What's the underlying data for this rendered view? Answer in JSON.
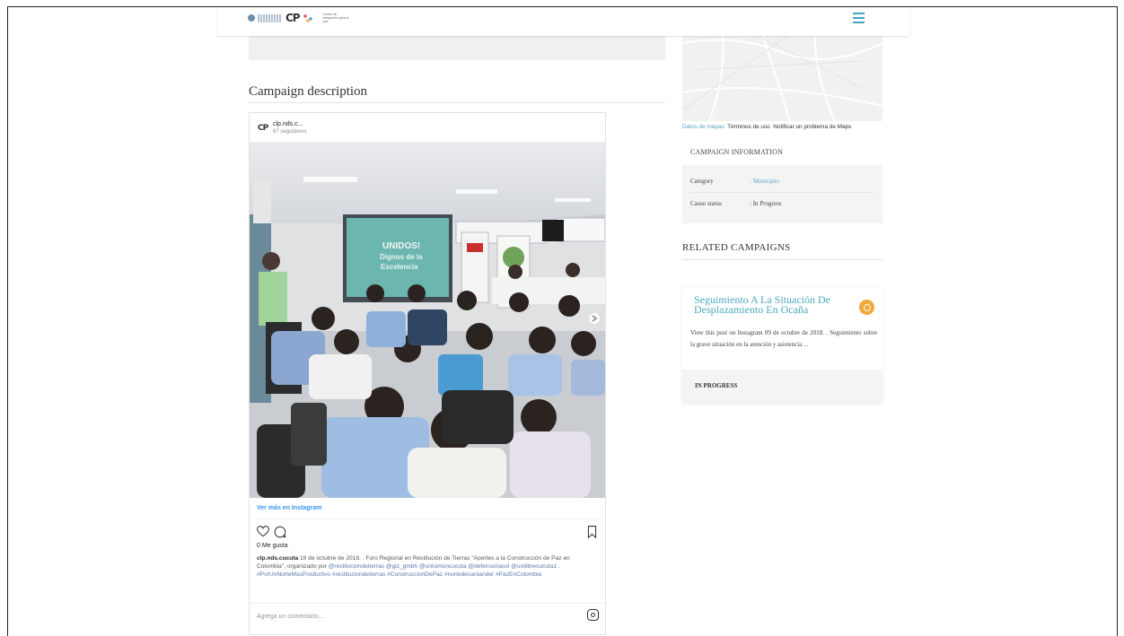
{
  "header": {
    "logo_text": "Centro de integración para la paz",
    "logo_mark": "CP"
  },
  "campaign": {
    "section_title": "Campaign description"
  },
  "instagram": {
    "avatar_mark": "CP",
    "username": "clp.nds.c...",
    "followers": "67 seguidores",
    "photo_slide_text": "UNIDOS! Dignos de la Excelencia",
    "view_more": "Ver más en Instagram",
    "likes": "0 Me gusta",
    "caption_user": "clp.nds.cucuta",
    "caption_text_1": " 19 de octubre de 2018. . Foro Regional en Restitución de Tierras \"Aportes a la Construcción de Paz en Colombia\", organizado por ",
    "caption_mention_1": "@restituciondetierras @giz_gmbh @unisimoncucuta @defensoriacol @unilibrecucuta1",
    "caption_text_2": " . ",
    "caption_tags": "#PorUnNorteMasProductivo #restituciondetierras #ConstruccionDePaz #nortedesantander #PazEnColombia",
    "add_comment_placeholder": "Agrega un comentario...",
    "icons": [
      "heart-icon",
      "comment-icon",
      "bookmark-icon",
      "instagram-icon"
    ]
  },
  "map": {
    "attrib_data": "Datos de mapas",
    "attrib_terms": "Términos de uso",
    "attrib_report": "Notificar un problema de Maps"
  },
  "campaign_info": {
    "title": "CAMPAIGN INFORMATION",
    "rows": [
      {
        "label": "Category",
        "value": ":  Municipio"
      },
      {
        "label": "Cause status",
        "value": ":  In Progress"
      }
    ]
  },
  "related": {
    "title": "RELATED CAMPAIGNS",
    "card": {
      "name": "Seguimiento A La Situación De Desplazamiento En Ocaña",
      "description": "View this post on Instagram 09 de octubre de 2018. . Seguimiento sobre la grave situación en la atención y asistencia ...",
      "status": "IN PROGRESS"
    }
  },
  "colors": {
    "accent": "#4aa9bd",
    "badge": "#f0a83a",
    "instagram_link": "#3897f0"
  }
}
